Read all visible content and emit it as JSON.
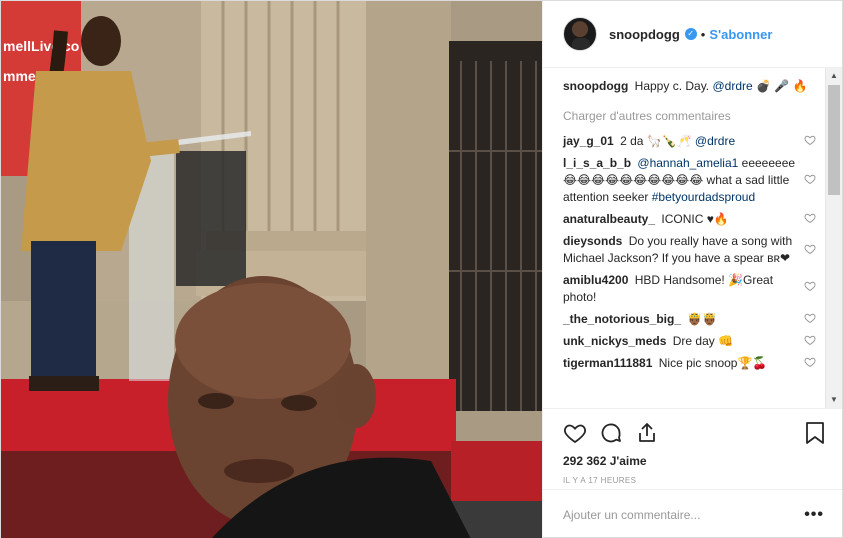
{
  "header": {
    "username": "snoopdogg",
    "separator": "•",
    "follow_label": "S'abonner"
  },
  "caption": {
    "username": "snoopdogg",
    "text": "Happy c. Day.",
    "mention": "@drdre",
    "emoji": "💣 🎤 🔥"
  },
  "load_more": "Charger d'autres commentaires",
  "comments": [
    {
      "username": "jay_g_01",
      "text": "2 da 🦙🍾🥂",
      "mention": "@drdre",
      "tag": ""
    },
    {
      "username": "l_i_s_a_b_b",
      "text": "",
      "mention": "@hannah_amelia1",
      "text2": "eeeeeeee 😂😂😂😂😂😂😂😂😂😂 what a sad little attention seeker",
      "tag": "#betyourdadsproud"
    },
    {
      "username": "anaturalbeauty_",
      "text": "ICONIC ♥🔥",
      "mention": "",
      "tag": ""
    },
    {
      "username": "dieysonds",
      "text": "Do you really have a song with Michael Jackson? If you have a spear ʙʀ❤",
      "mention": "",
      "tag": ""
    },
    {
      "username": "amiblu4200",
      "text": "HBD Handsome! 🎉Great photo!",
      "mention": "",
      "tag": ""
    },
    {
      "username": "_the_notorious_big_",
      "text": "🤴🏾🤴🏾",
      "mention": "",
      "tag": ""
    },
    {
      "username": "unk_nickys_meds",
      "text": "Dre day 👊",
      "mention": "",
      "tag": ""
    },
    {
      "username": "tigerman111881",
      "text": "Nice pic snoop🏆🍒",
      "mention": "",
      "tag": ""
    }
  ],
  "likes": "292 362 J'aime",
  "timestamp": "IL Y A 17 HEURES",
  "comment_input": {
    "placeholder": "Ajouter un commentaire..."
  },
  "more_label": "•••",
  "icons": {
    "like": "heart-icon",
    "comment": "comment-icon",
    "share": "share-icon",
    "save": "bookmark-icon",
    "verified": "verified-badge-icon"
  },
  "photo": {
    "sign_text": "mellLive.co",
    "sign_text2": "mmell"
  },
  "colors": {
    "link_blue": "#3897f0",
    "mention_blue": "#003569",
    "muted": "#999999"
  }
}
